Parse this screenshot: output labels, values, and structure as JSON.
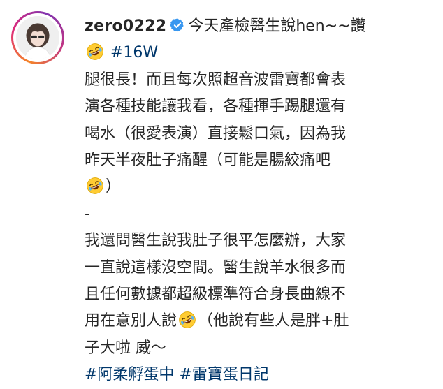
{
  "post": {
    "username": "zero0222",
    "verified_icon": "verified-badge-icon",
    "emoji_icon": "rolling-on-floor-laughing-emoji",
    "colors": {
      "hashtag": "#00376b",
      "text": "#262626",
      "verified": "#3897f0"
    },
    "caption": {
      "line1": "今天產檢醫生說hen~~讚",
      "hashtag_16w": "#16W",
      "line3": "腿很長！而且每次照超音波雷寶都會表",
      "line4": "演各種技能讓我看，各種揮手踢腿還有",
      "line5": "喝水（很愛表演）直接鬆口氣，因為我",
      "line6": "昨天半夜肚子痛醒（可能是腸絞痛吧",
      "line7": "）",
      "line8": "-",
      "line9": "我還問醫生說我肚子很平怎麼辦，大家",
      "line10": "一直說這樣沒空間。醫生說羊水很多而",
      "line11": "且任何數據都超級標準符合身長曲線不",
      "line12a": "用在意別人說",
      "line12b": "（他說有些人是胖+肚",
      "line13": "子大啦 威～",
      "hashtag_1": "#阿柔孵蛋中",
      "hashtag_2": "#雷寶蛋日記"
    }
  }
}
